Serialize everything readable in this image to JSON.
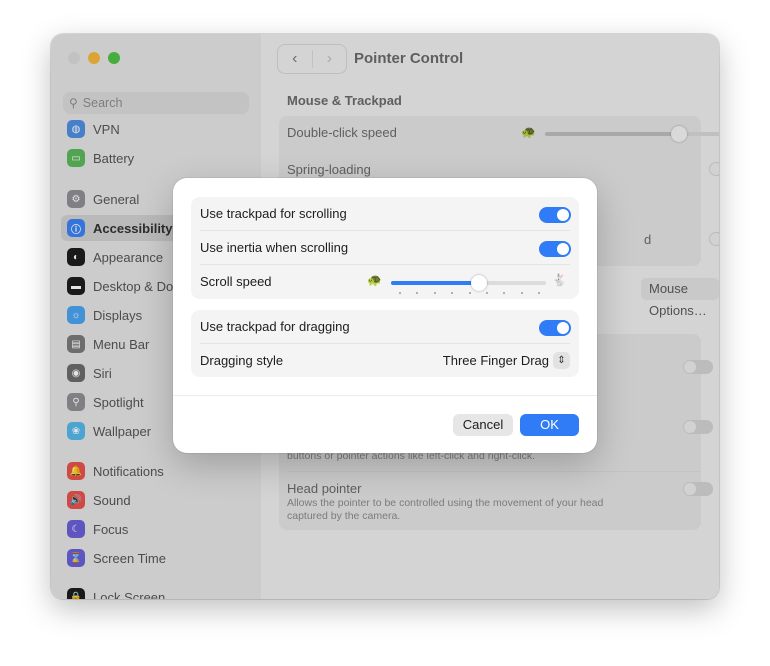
{
  "sidebar": {
    "search_placeholder": "Search",
    "items": [
      {
        "label": "VPN",
        "icon": "globe-icon",
        "color": "#4f8fe0"
      },
      {
        "label": "Battery",
        "icon": "battery-icon",
        "color": "#5bb75a"
      },
      {
        "label": "General",
        "icon": "gear-icon",
        "color": "#8e8e93"
      },
      {
        "label": "Accessibility",
        "icon": "accessibility-icon",
        "color": "#3b82f6"
      },
      {
        "label": "Appearance",
        "icon": "appearance-icon",
        "color": "#1d1d1f"
      },
      {
        "label": "Desktop & Dock",
        "icon": "dock-icon",
        "color": "#1d1d1f"
      },
      {
        "label": "Displays",
        "icon": "displays-icon",
        "color": "#4aa3f0"
      },
      {
        "label": "Menu Bar",
        "icon": "menubar-icon",
        "color": "#7a7a7a"
      },
      {
        "label": "Siri",
        "icon": "siri-icon",
        "color": "#6b6b6b"
      },
      {
        "label": "Spotlight",
        "icon": "spotlight-icon",
        "color": "#8e8e93"
      },
      {
        "label": "Wallpaper",
        "icon": "wallpaper-icon",
        "color": "#55b8e8"
      },
      {
        "label": "Notifications",
        "icon": "bell-icon",
        "color": "#e8534d"
      },
      {
        "label": "Sound",
        "icon": "speaker-icon",
        "color": "#e8534d"
      },
      {
        "label": "Focus",
        "icon": "moon-icon",
        "color": "#6a5fd6"
      },
      {
        "label": "Screen Time",
        "icon": "hourglass-icon",
        "color": "#6a5fd6"
      },
      {
        "label": "Lock Screen",
        "icon": "lock-icon",
        "color": "#1d1d1f"
      }
    ]
  },
  "toolbar": {
    "title": "Pointer Control",
    "back_glyph": "‹",
    "forward_glyph": "›"
  },
  "background": {
    "section_header": "Mouse & Trackpad",
    "double_click_label": "Double-click speed",
    "spring_loading_label": "Spring-loading",
    "partial_label_end": "d",
    "mouse_options_label": "Mouse Options…",
    "alt_text_fragment": "buttons or pointer actions like left-click and right-click.",
    "head_pointer_label": "Head pointer",
    "head_pointer_desc_1": "Allows the pointer to be controlled using the movement of your head",
    "head_pointer_desc_2": "captured by the camera.",
    "help_glyph": "?",
    "info_glyph": "i"
  },
  "dialog": {
    "scroll_trackpad_label": "Use trackpad for scrolling",
    "scroll_trackpad_on": true,
    "inertia_label": "Use inertia when scrolling",
    "inertia_on": true,
    "scroll_speed_label": "Scroll speed",
    "scroll_speed_value": 0.57,
    "drag_trackpad_label": "Use trackpad for dragging",
    "drag_trackpad_on": true,
    "dragging_style_label": "Dragging style",
    "dragging_style_value": "Three Finger Drag",
    "cancel_label": "Cancel",
    "ok_label": "OK",
    "accent": "#2f7cf6"
  }
}
